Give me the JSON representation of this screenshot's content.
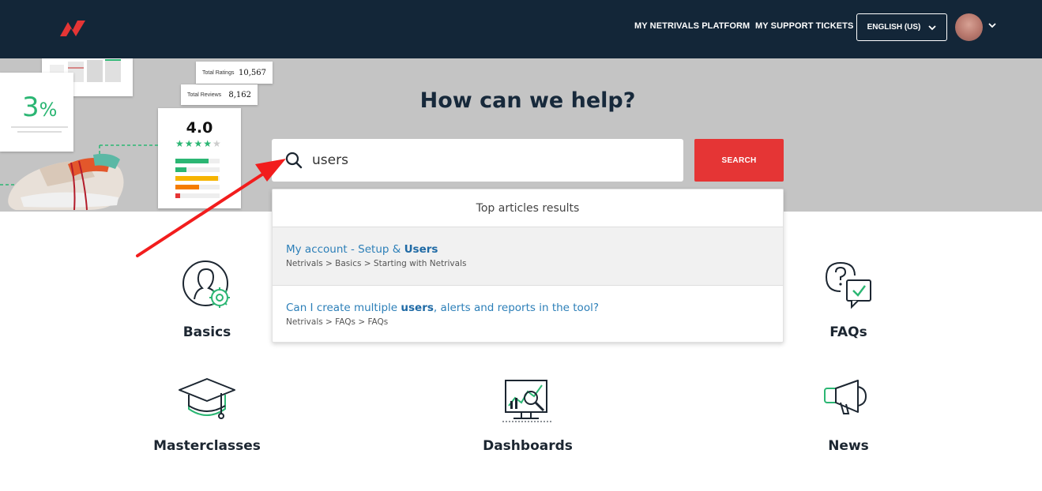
{
  "header": {
    "logo_icon": "netrivals-logo",
    "nav": [
      {
        "label": "MY NETRIVALS PLATFORM"
      },
      {
        "label": "MY SUPPORT TICKETS"
      }
    ],
    "language": "ENGLISH (US)",
    "colors": {
      "bar": "#132638",
      "accent": "#e53535"
    }
  },
  "hero": {
    "title": "How can we help?",
    "collage": {
      "percent_big": "3",
      "percent_sign": "%",
      "rating": "4.0",
      "total_ratings_label": "Total Ratings",
      "total_ratings_value": "10,567",
      "total_reviews_label": "Total Reviews",
      "total_reviews_value": "8,162"
    }
  },
  "search": {
    "value": "users",
    "button_label": "SEARCH"
  },
  "results": {
    "header": "Top articles results",
    "items": [
      {
        "title_pre": "My account - Setup & ",
        "title_match": "Users",
        "title_post": "",
        "path": "Netrivals > Basics > Starting with Netrivals"
      },
      {
        "title_pre": "Can I create multiple ",
        "title_match": "users",
        "title_post": ", alerts and reports in the tool?",
        "path": "Netrivals > FAQs > FAQs"
      }
    ]
  },
  "categories": [
    {
      "label": "Basics",
      "icon": "user-gear-icon"
    },
    {
      "label": "FAQs",
      "icon": "question-chat-icon"
    },
    {
      "label": "Masterclasses",
      "icon": "graduation-cap-icon"
    },
    {
      "label": "Dashboards",
      "icon": "dashboard-chart-icon"
    },
    {
      "label": "News",
      "icon": "megaphone-icon"
    }
  ]
}
